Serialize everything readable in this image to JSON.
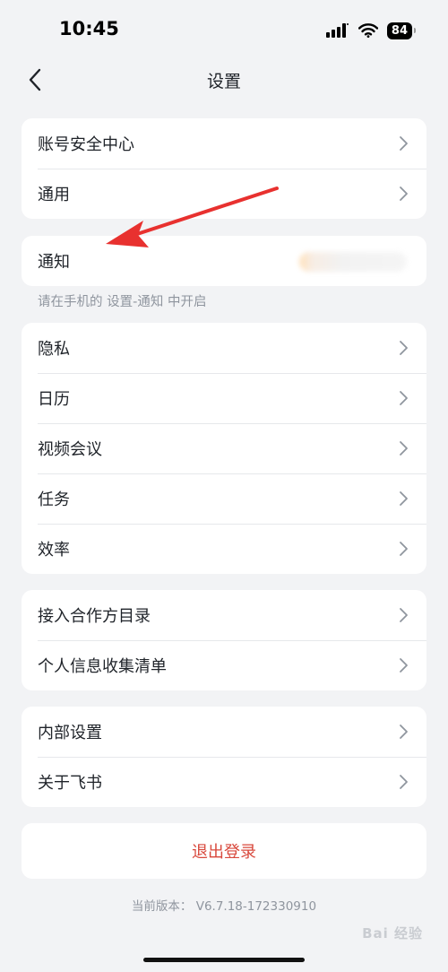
{
  "status_bar": {
    "time": "10:45",
    "battery": "84"
  },
  "nav": {
    "title": "设置"
  },
  "group1": {
    "items": [
      "账号安全中心",
      "通用"
    ]
  },
  "group2": {
    "item": "通知",
    "hint": "请在手机的 设置-通知 中开启"
  },
  "group3": {
    "items": [
      "隐私",
      "日历",
      "视频会议",
      "任务",
      "效率"
    ]
  },
  "group4": {
    "items": [
      "接入合作方目录",
      "个人信息收集清单"
    ]
  },
  "group5": {
    "items": [
      "内部设置",
      "关于飞书"
    ]
  },
  "logout": {
    "label": "退出登录"
  },
  "version": {
    "text": "当前版本： V6.7.18-172330910"
  },
  "watermark": {
    "text": "Bai 经验"
  },
  "colors": {
    "background": "#f2f3f5",
    "card": "#ffffff",
    "logout": "#d8483c",
    "arrow": "#e8312f",
    "hint": "#8f959e"
  },
  "icons": {
    "back": "chevron-left-icon",
    "row": "chevron-right-icon"
  }
}
